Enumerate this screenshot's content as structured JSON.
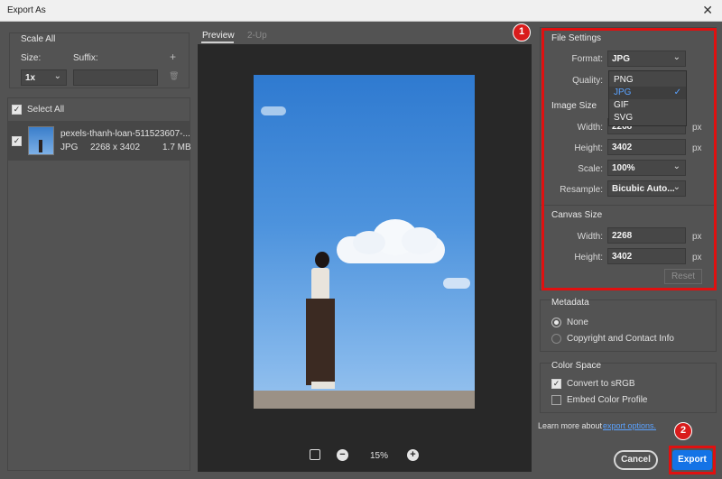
{
  "window": {
    "title": "Export As",
    "close_glyph": "✕"
  },
  "left": {
    "scale_all": "Scale All",
    "size_label": "Size:",
    "suffix_label": "Suffix:",
    "size_value": "1x",
    "add_glyph": "+",
    "trash_glyph": "🗑",
    "select_all": "Select All",
    "file": {
      "name": "pexels-thanh-loan-511523607-...",
      "format": "JPG",
      "dims": "2268 x 3402",
      "size": "1.7 MB"
    }
  },
  "preview": {
    "tabs": [
      {
        "label": "Preview"
      },
      {
        "label": "2-Up"
      }
    ],
    "zoom": "15%",
    "zoom_out_glyph": "−",
    "zoom_in_glyph": "+"
  },
  "file_settings": {
    "header": "File Settings",
    "format_label": "Format:",
    "format_value": "JPG",
    "quality_label": "Quality:",
    "options": [
      {
        "label": "PNG"
      },
      {
        "label": "JPG"
      },
      {
        "label": "GIF"
      },
      {
        "label": "SVG"
      }
    ],
    "check_glyph": "✓"
  },
  "image_size": {
    "header": "Image Size",
    "width_label": "Width:",
    "width_value": "2268",
    "height_label": "Height:",
    "height_value": "3402",
    "scale_label": "Scale:",
    "scale_value": "100%",
    "resample_label": "Resample:",
    "resample_value": "Bicubic Auto...",
    "unit": "px"
  },
  "canvas_size": {
    "header": "Canvas Size",
    "width_label": "Width:",
    "width_value": "2268",
    "height_label": "Height:",
    "height_value": "3402",
    "unit": "px",
    "reset_label": "Reset"
  },
  "metadata": {
    "header": "Metadata",
    "none_label": "None",
    "copyright_label": "Copyright and Contact Info"
  },
  "color_space": {
    "header": "Color Space",
    "srgb_label": "Convert to sRGB",
    "embed_label": "Embed Color Profile"
  },
  "footer": {
    "learn_more": "Learn more about",
    "export_link": "export options.",
    "cancel_label": "Cancel",
    "export_label": "Export"
  },
  "badges": {
    "one": "1",
    "two": "2"
  },
  "colors": {
    "accent": "#1473e6",
    "annotation_red": "#e01010",
    "link": "#5aa2ff"
  }
}
